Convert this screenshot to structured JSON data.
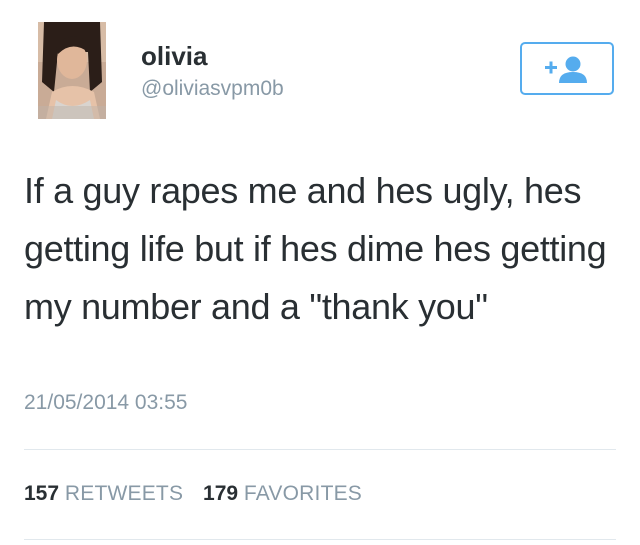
{
  "tweet": {
    "author": {
      "display_name": "olivia",
      "username": "@oliviasvpm0b",
      "avatar_icon": "profile-photo"
    },
    "follow_button": {
      "icon": "add-user-icon",
      "color": "#55acee"
    },
    "text": "If a guy rapes me and hes ugly, hes getting life but if hes dime hes getting my number and a \"thank you\"",
    "timestamp": "21/05/2014 03:55",
    "stats": {
      "retweets": {
        "count": "157",
        "label": "RETWEETS"
      },
      "favorites": {
        "count": "179",
        "label": "FAVORITES"
      }
    }
  },
  "colors": {
    "text_primary": "#292f33",
    "text_secondary": "#8899a6",
    "accent": "#55acee",
    "divider": "#e1e8ed"
  }
}
